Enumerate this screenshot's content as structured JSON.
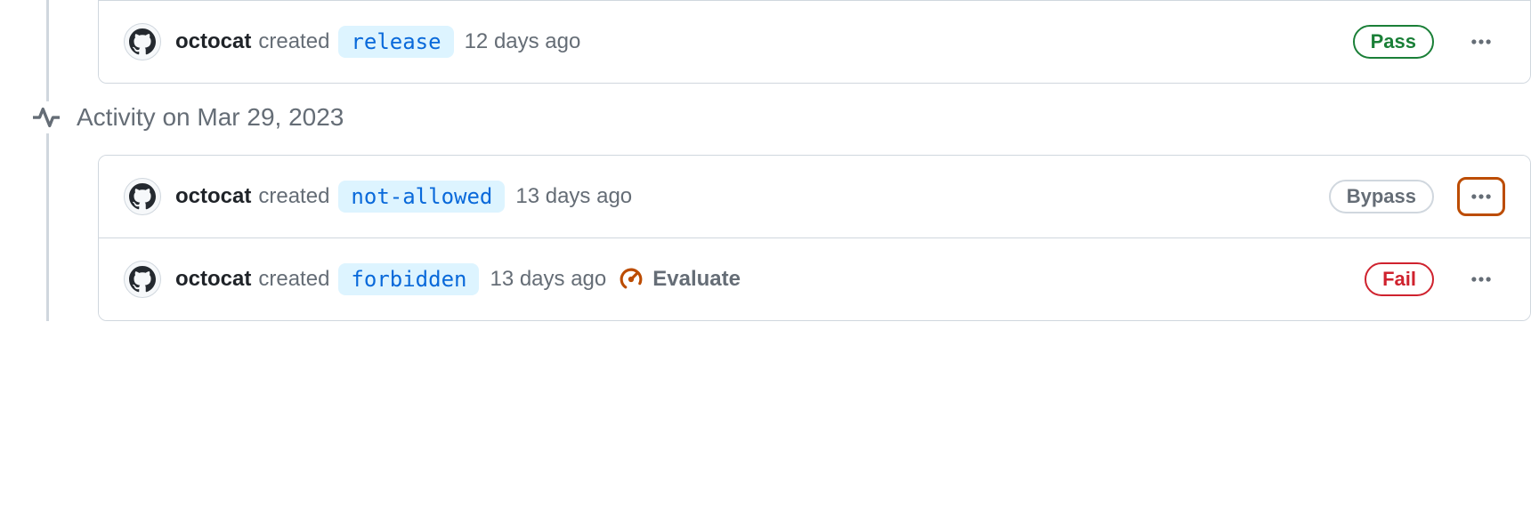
{
  "groups": [
    {
      "title": "",
      "entries": [
        {
          "user": "octocat",
          "action": "created",
          "tag": "release",
          "time": "12 days ago",
          "status": "Pass",
          "statusType": "pass",
          "evaluate": false,
          "highlightMenu": false
        }
      ]
    },
    {
      "title": "Activity on Mar 29, 2023",
      "entries": [
        {
          "user": "octocat",
          "action": "created",
          "tag": "not-allowed",
          "time": "13 days ago",
          "status": "Bypass",
          "statusType": "bypass",
          "evaluate": false,
          "highlightMenu": true
        },
        {
          "user": "octocat",
          "action": "created",
          "tag": "forbidden",
          "time": "13 days ago",
          "status": "Fail",
          "statusType": "fail",
          "evaluate": true,
          "evaluateLabel": "Evaluate",
          "highlightMenu": false
        }
      ]
    }
  ]
}
